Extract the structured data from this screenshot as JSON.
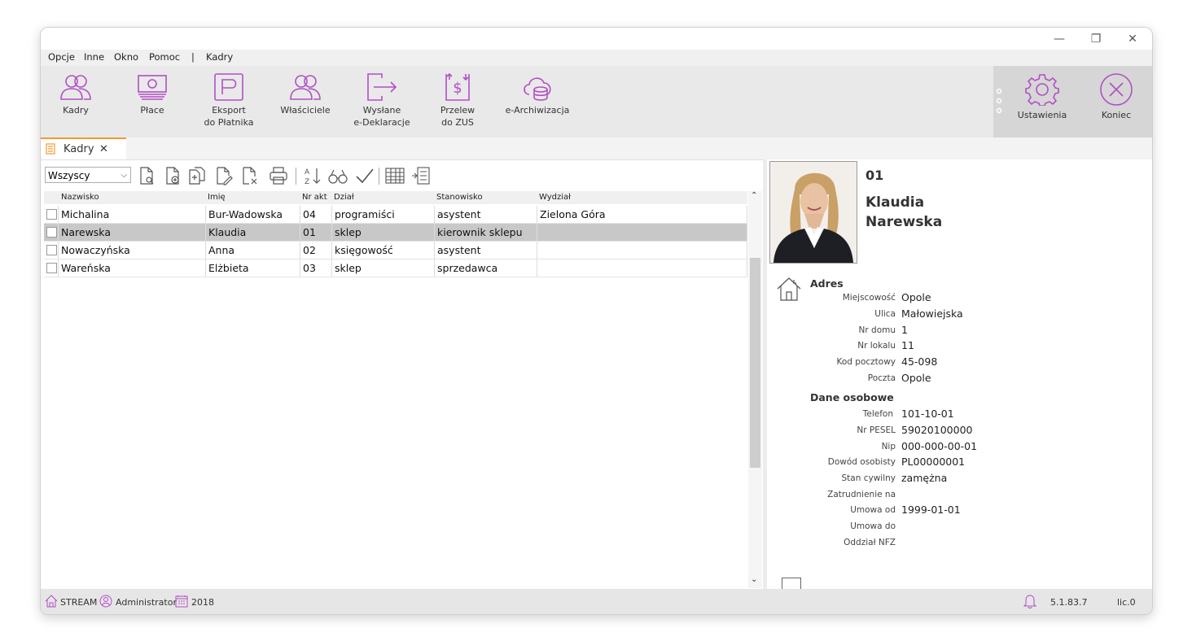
{
  "window": {
    "controls": {
      "minimize": "—",
      "restore": "❐",
      "close": "✕"
    }
  },
  "menu": {
    "items": [
      "Opcje",
      "Inne",
      "Okno",
      "Pomoc",
      "|",
      "Kadry"
    ]
  },
  "ribbon": {
    "buttons": [
      {
        "line1": "Kadry",
        "line2": ""
      },
      {
        "line1": "Płace",
        "line2": ""
      },
      {
        "line1": "Eksport",
        "line2": "do Płatnika"
      },
      {
        "line1": "Właściciele",
        "line2": ""
      },
      {
        "line1": "Wysłane",
        "line2": "e-Deklaracje"
      },
      {
        "line1": "Przelew",
        "line2": "do ZUS"
      },
      {
        "line1": "e-Archiwizacja",
        "line2": ""
      }
    ],
    "settings_label": "Ustawienia",
    "exit_label": "Koniec",
    "accent_color": "#b14fc5"
  },
  "tab": {
    "label": "Kadry",
    "close": "✕"
  },
  "filter": {
    "value": "Wszyscy"
  },
  "table": {
    "columns": [
      "Nazwisko",
      "Imię",
      "Nr akt",
      "Dział",
      "Stanowisko",
      "Wydział"
    ],
    "rows": [
      [
        "Michalina",
        "Bur-Wadowska",
        "04",
        "programiści",
        "asystent",
        "Zielona Góra"
      ],
      [
        "Narewska",
        "Klaudia",
        "01",
        "sklep",
        "kierownik sklepu",
        ""
      ],
      [
        "Nowaczyńska",
        "Anna",
        "02",
        "księgowość",
        "asystent",
        ""
      ],
      [
        "Wareńska",
        "Elżbieta",
        "03",
        "sklep",
        "sprzedawca",
        ""
      ]
    ],
    "selected_row": 1
  },
  "detail": {
    "number": "01",
    "first_name": "Klaudia",
    "last_name": "Narewska",
    "address_title": "Adres",
    "address": [
      {
        "label": "Miejscowość",
        "value": "Opole"
      },
      {
        "label": "Ulica",
        "value": "Małowiejska"
      },
      {
        "label": "Nr domu",
        "value": "1"
      },
      {
        "label": "Nr lokalu",
        "value": "11"
      },
      {
        "label": "Kod pocztowy",
        "value": "45-098"
      },
      {
        "label": "Poczta",
        "value": "Opole"
      }
    ],
    "personal_title": "Dane osobowe",
    "personal": [
      {
        "label": "Telefon",
        "value": "101-10-01"
      },
      {
        "label": "Nr PESEL",
        "value": "59020100000"
      },
      {
        "label": "Nip",
        "value": "000-000-00-01"
      },
      {
        "label": "Dowód osobisty",
        "value": "PL00000001"
      },
      {
        "label": "Stan cywilny",
        "value": "zamężna"
      },
      {
        "label": "Zatrudnienie na",
        "value": ""
      },
      {
        "label": "Umowa od",
        "value": "1999-01-01"
      },
      {
        "label": "Umowa do",
        "value": ""
      },
      {
        "label": "Oddział NFZ",
        "value": ""
      }
    ]
  },
  "status": {
    "company": "STREAM",
    "user": "Administrator",
    "year": "2018",
    "version": "5.1.83.7",
    "license": "lic.0"
  }
}
